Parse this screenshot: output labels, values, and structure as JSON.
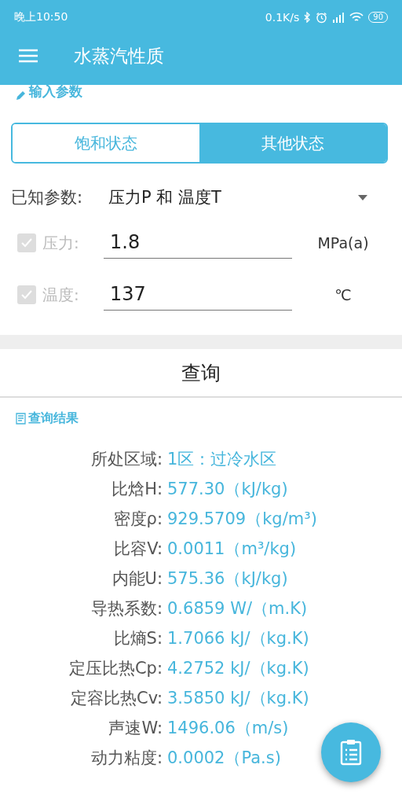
{
  "status_bar": {
    "time": "晚上10:50",
    "speed": "0.1K/s",
    "battery": "90"
  },
  "app_bar": {
    "title": "水蒸汽性质"
  },
  "input_section": {
    "title": "输入参数"
  },
  "tabs": [
    {
      "label": "饱和状态",
      "selected": false
    },
    {
      "label": "其他状态",
      "selected": true
    }
  ],
  "known_params": {
    "label": "已知参数:",
    "value": "压力P 和 温度T"
  },
  "fields": [
    {
      "label": "压力:",
      "value": "1.8",
      "unit": "MPa(a)",
      "checked": true,
      "disabled": true
    },
    {
      "label": "温度:",
      "value": "137",
      "unit": "℃",
      "checked": true,
      "disabled": true
    }
  ],
  "query_button": "查询",
  "results_section": {
    "title": "查询结果"
  },
  "results": [
    {
      "label": "所处区域:",
      "value": "1区：过冷水区"
    },
    {
      "label": "比焓H:",
      "value": "577.30（kJ/kg)"
    },
    {
      "label": "密度ρ:",
      "value": "929.5709（kg/m³)"
    },
    {
      "label": "比容V:",
      "value": "0.0011（m³/kg)"
    },
    {
      "label": "内能U:",
      "value": "575.36（kJ/kg)"
    },
    {
      "label": "导热系数:",
      "value": "0.6859 W/（m.K)"
    },
    {
      "label": "比熵S:",
      "value": "1.7066 kJ/（kg.K)"
    },
    {
      "label": "定压比热Cp:",
      "value": "4.2752 kJ/（kg.K)"
    },
    {
      "label": "定容比热Cv:",
      "value": "3.5850 kJ/（kg.K)"
    },
    {
      "label": "声速W:",
      "value": "1496.06（m/s)"
    },
    {
      "label": "动力粘度:",
      "value": "0.0002（Pa.s)"
    }
  ]
}
